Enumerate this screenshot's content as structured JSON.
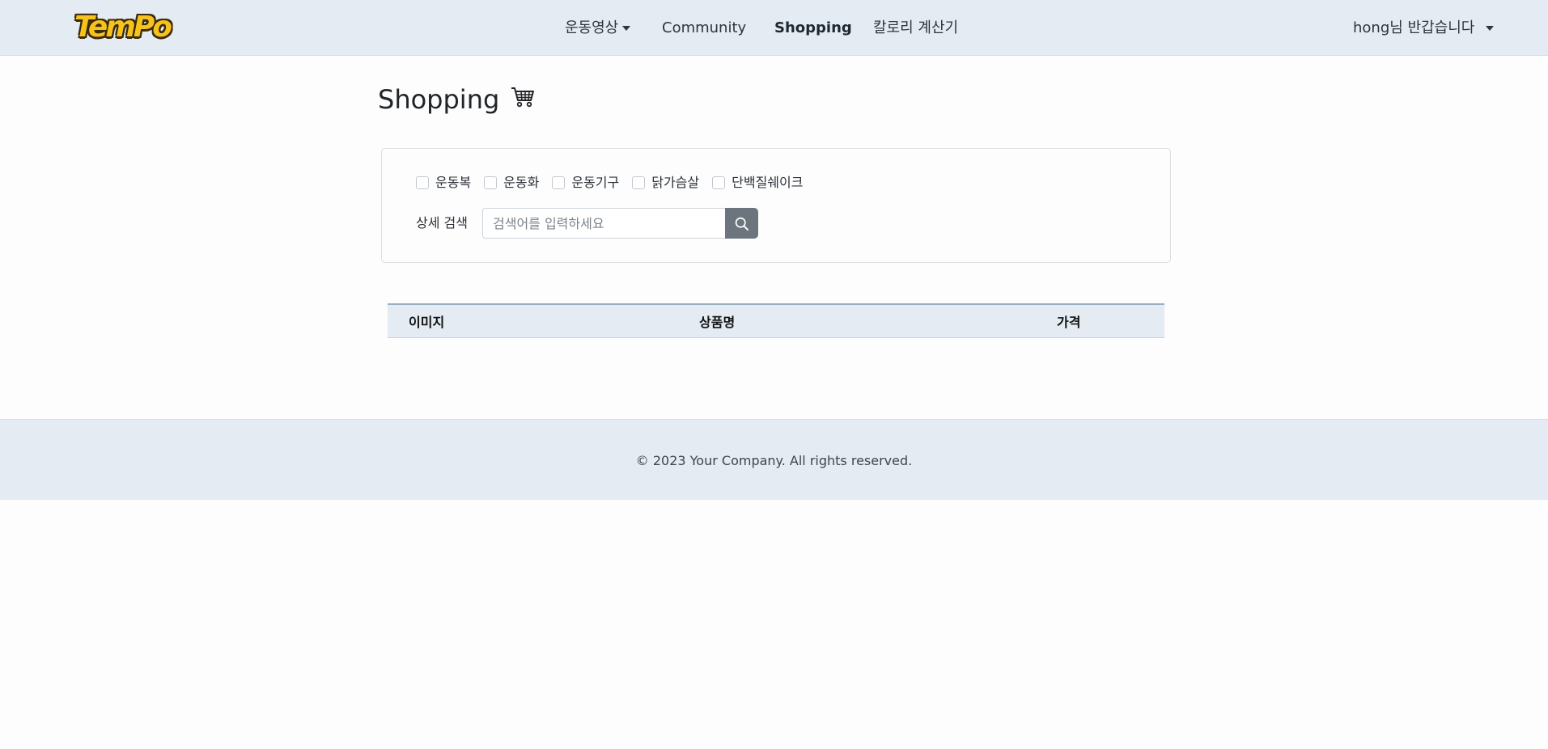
{
  "navbar": {
    "logo_text": "TemPo",
    "items": [
      {
        "label": "운동영상",
        "has_dropdown": true
      },
      {
        "label": "Community"
      },
      {
        "label": "Shopping",
        "active": true
      },
      {
        "label": "칼로리 계산기"
      }
    ],
    "user_greeting": "hong님 반갑습니다"
  },
  "page": {
    "title": "Shopping",
    "title_icon": "shopping-cart-icon"
  },
  "filter": {
    "categories": [
      {
        "label": "운동복",
        "checked": false
      },
      {
        "label": "운동화",
        "checked": false
      },
      {
        "label": "운동기구",
        "checked": false
      },
      {
        "label": "닭가슴살",
        "checked": false
      },
      {
        "label": "단백질쉐이크",
        "checked": false
      }
    ],
    "search_label": "상세 검색",
    "search_placeholder": "검색어를 입력하세요",
    "search_value": "",
    "search_button_icon": "search-icon"
  },
  "table": {
    "headers": [
      "이미지",
      "상품명",
      "가격"
    ],
    "rows": []
  },
  "footer": {
    "copyright": "© 2023 Your Company. All rights reserved."
  },
  "colors": {
    "navbar_bg": "#e4ebf2",
    "search_button": "#6c757d",
    "logo_yellow": "#f6c21c"
  }
}
